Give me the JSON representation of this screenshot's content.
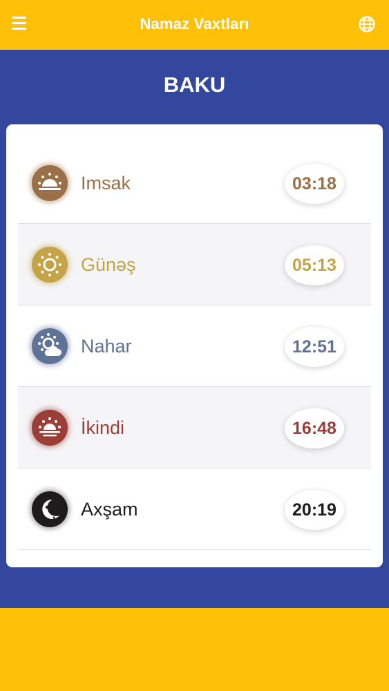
{
  "header": {
    "title": "Namaz Vaxtları",
    "menu_icon": "hamburger-menu-icon",
    "language_icon": "globe-icon"
  },
  "city": "BAKU",
  "prayers": [
    {
      "name": "Imsak",
      "time": "03:18",
      "color": "#9C7046",
      "icon": "sunrise-icon"
    },
    {
      "name": "Günəş",
      "time": "05:13",
      "color": "#C4A447",
      "icon": "sun-icon"
    },
    {
      "name": "Nahar",
      "time": "12:51",
      "color": "#5F7397",
      "icon": "sun-cloud-icon"
    },
    {
      "name": "İkindi",
      "time": "16:48",
      "color": "#9B3E38",
      "icon": "sunset-icon"
    },
    {
      "name": "Axşam",
      "time": "20:19",
      "color": "#1E1B1C",
      "icon": "moon-icon"
    }
  ],
  "colors": {
    "accent": "#FFC107",
    "primary": "#32479D"
  }
}
